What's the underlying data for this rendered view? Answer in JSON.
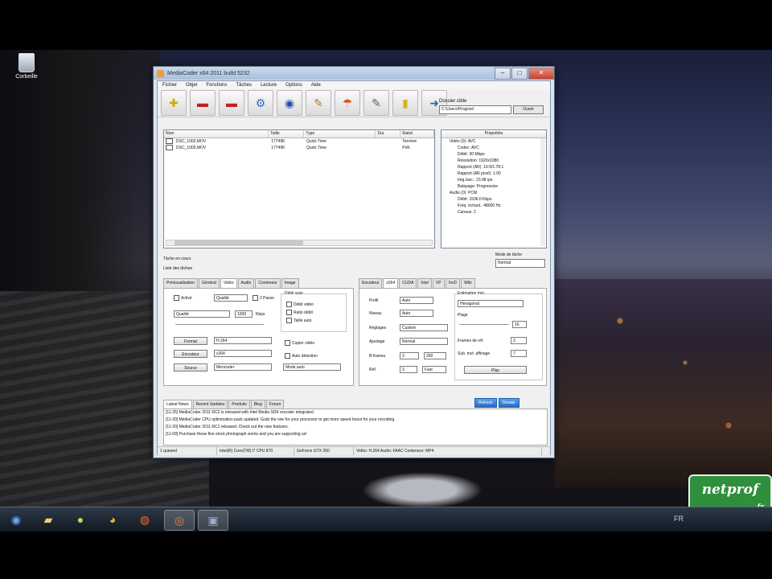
{
  "desktop": {
    "icon_label": "Corbeille",
    "watermark": {
      "text": "netprof",
      "suffix": ".fr"
    }
  },
  "taskbar": {
    "items": [
      "windows-start",
      "explorer",
      "media-player",
      "chrome",
      "firefox",
      "mediacoder",
      "app"
    ],
    "tray_text": "FR"
  },
  "window": {
    "title": "MediaCoder x64 2011 build 5232",
    "menu": [
      "Fichier",
      "Objet",
      "Fonctions",
      "Tâches",
      "Lecture",
      "Options",
      "Aide"
    ],
    "toolbar": [
      {
        "name": "add-file",
        "glyph": "✚"
      },
      {
        "name": "remove",
        "glyph": "▬"
      },
      {
        "name": "clear",
        "glyph": "▬"
      },
      {
        "name": "wizard",
        "glyph": "⚙"
      },
      {
        "name": "play",
        "glyph": "◉"
      },
      {
        "name": "edit",
        "glyph": "✎"
      },
      {
        "name": "extensions",
        "glyph": "☂"
      },
      {
        "name": "settings",
        "glyph": "✎"
      },
      {
        "name": "info",
        "glyph": "▮"
      },
      {
        "name": "start",
        "glyph": "➜"
      }
    ],
    "destination": {
      "label": "Dossier cible",
      "value": "C:\\Users\\Progiciel",
      "open_label": "Ouvrir"
    },
    "files": {
      "columns": [
        "Nom",
        "Taille",
        "Type",
        "Dur.",
        "Statut"
      ],
      "rows": [
        {
          "name": "DSC_1003.MOV",
          "size": "17749K",
          "type": "Quick Time",
          "dur": "",
          "status": "Terminé"
        },
        {
          "name": "DSC_1003.MOV",
          "size": "17749K",
          "type": "Quick Time",
          "dur": "",
          "status": "Prêt"
        }
      ]
    },
    "properties": {
      "header": "Propriétés",
      "rows": [
        {
          "level": 1,
          "text": "Vidéo (0): AVC"
        },
        {
          "level": 2,
          "text": "Codec: AVC"
        },
        {
          "level": 2,
          "text": "Débit: 30 Mbps"
        },
        {
          "level": 2,
          "text": "Résolution: 1920x1080"
        },
        {
          "level": 2,
          "text": "Rapport (AR): 16:9/1.78:1"
        },
        {
          "level": 2,
          "text": "Rapport (AR pixel): 1.00"
        },
        {
          "level": 2,
          "text": "Img./sec.: 23.98 ips"
        },
        {
          "level": 2,
          "text": "Balayage: Progressive"
        },
        {
          "level": 1,
          "text": "Audio (0): PCM"
        },
        {
          "level": 2,
          "text": "Débit: 1536.0 Kbps"
        },
        {
          "level": 2,
          "text": "Fréq. échant.: 48000 Hz"
        },
        {
          "level": 2,
          "text": "Canaux: 2"
        }
      ]
    },
    "status": {
      "current_task": "Tâche en cours",
      "task_list": "Liste des tâches",
      "mode_label": "Mode de tâche",
      "mode_value": "Normal"
    },
    "tabs_left": [
      "Prévisualisation",
      "Général",
      "Vidéo",
      "Audio",
      "Conteneur",
      "Image"
    ],
    "tabs_right": [
      "Encodeur",
      "x264",
      "CUDA",
      "Intel",
      "VP",
      "XviD",
      "Wiki"
    ],
    "video_pane": {
      "enable_label": "Activé",
      "mode_value": "Qualité",
      "two_pass_label": "2 Passe",
      "bitrate_value": "1000",
      "bitrate_unit": "Kbps",
      "format_label": "Format",
      "format_value": "H.264",
      "encoder_label": "Encodeur",
      "encoder_value": "x264",
      "source_label": "Source",
      "source_value": "Mencoder",
      "group_label": "Débit auto",
      "opt1": "Débit vidéo",
      "opt2": "Ratio débit",
      "opt3": "Taille auto",
      "copy_label": "Copier vidéo",
      "same_label": "Auto détection",
      "auto_value": "Mode auto"
    },
    "encoder_pane": {
      "profile_label": "Profil",
      "profile_value": "Auto",
      "level_label": "Niveau",
      "level_value": "Auto",
      "preset_label": "Réglages",
      "preset_value": "Custom",
      "tune_label": "Ajustage",
      "tune_value": "Normal",
      "bframes_label": "B-frames",
      "bframes_value": "3",
      "bframes_value2": "250",
      "refs_label": "Réf.",
      "refs_value": "3",
      "refs_value2": "Fast",
      "analysis_label": "Estimation mvt.",
      "analysis_value": "Hexagonal",
      "range_label": "Plage",
      "range_value": "16",
      "ratio_label": "Frames de réf.",
      "ratio_value": "3",
      "threads_label": "Sub. mvt. affinage",
      "threads_value": "7",
      "play_label": "Play"
    },
    "log": {
      "tabs": [
        "Latest News",
        "Recent Updates",
        "Produits",
        "Blog",
        "Forum"
      ],
      "refresh_label": "Refresh",
      "donate_label": "Donate",
      "lines": [
        "[11-25] MediaCoder 2011 RC2 is released with Intel Media SDK encoder integrated",
        "[11-20] MediaCoder CPU optimization pack updated. Grab the one for your processor to get more speed boost for your encoding.",
        "[11-20] MediaCoder 2011 RC1 released. Check out the new features.",
        "[11-09] Purchase these fine stock photograph works and you are supporting us!"
      ]
    },
    "statusbar": [
      "1 queued",
      "Intel(R) Core(TM) i7 CPU 870",
      "GeForce GTX 260",
      "Vidéo: H.264  Audio: FAAC  Conteneur: MP4"
    ]
  }
}
